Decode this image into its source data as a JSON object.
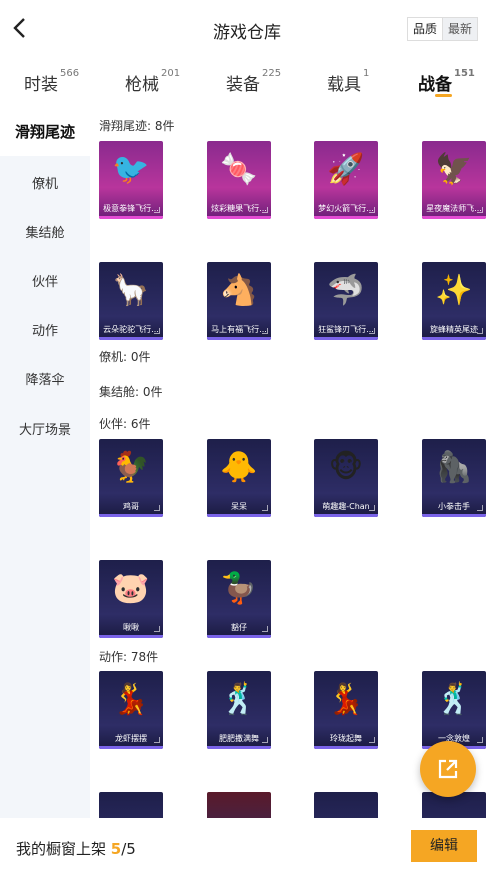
{
  "header": {
    "title": "游戏仓库",
    "sort_options": [
      "品质",
      "最新"
    ]
  },
  "tabs": [
    {
      "label": "时装",
      "count": "566"
    },
    {
      "label": "枪械",
      "count": "201"
    },
    {
      "label": "装备",
      "count": "225"
    },
    {
      "label": "载具",
      "count": "1"
    },
    {
      "label": "战备",
      "count": "151"
    }
  ],
  "sidebar": [
    "滑翔尾迹",
    "僚机",
    "集结舱",
    "伙伴",
    "动作",
    "降落伞",
    "大厅场景"
  ],
  "sections": {
    "trail": {
      "title": "滑翔尾迹: 8件",
      "items": [
        {
          "label": "极意拳锋飞行...",
          "icon": "🐦"
        },
        {
          "label": "炫彩糖果飞行...",
          "icon": "🍬"
        },
        {
          "label": "梦幻火箭飞行...",
          "icon": "🚀"
        },
        {
          "label": "星夜魔法师飞...",
          "icon": "🦅"
        },
        {
          "label": "云朵驼驼飞行...",
          "icon": "🦙"
        },
        {
          "label": "马上有福飞行...",
          "icon": "🐴"
        },
        {
          "label": "狂鲨锋刃飞行...",
          "icon": "🦈"
        },
        {
          "label": "旋蜂精英尾迹",
          "icon": "✨"
        }
      ]
    },
    "wingman": {
      "title": "僚机: 0件"
    },
    "pod": {
      "title": "集结舱: 0件"
    },
    "partner": {
      "title": "伙伴: 6件",
      "items": [
        {
          "label": "鸡哥",
          "icon": "🐓"
        },
        {
          "label": "呆呆",
          "icon": "🐥"
        },
        {
          "label": "萌趣趣-Chan",
          "icon": "🐵"
        },
        {
          "label": "小拳击手",
          "icon": "🦍"
        },
        {
          "label": "啾啾",
          "icon": "🐷"
        },
        {
          "label": "豁仔",
          "icon": "🦆"
        }
      ]
    },
    "emote": {
      "title": "动作: 78件",
      "items": [
        {
          "label": "龙虾摆摆",
          "icon": "💃"
        },
        {
          "label": "肥肥撒满舞",
          "icon": "🕺"
        },
        {
          "label": "玲珑起舞",
          "icon": "💃"
        },
        {
          "label": "一念敦煌",
          "icon": "🕺"
        }
      ]
    }
  },
  "footer": {
    "prefix": "我的橱窗上架 ",
    "current": "5",
    "total": "/5",
    "edit_label": "编辑"
  }
}
